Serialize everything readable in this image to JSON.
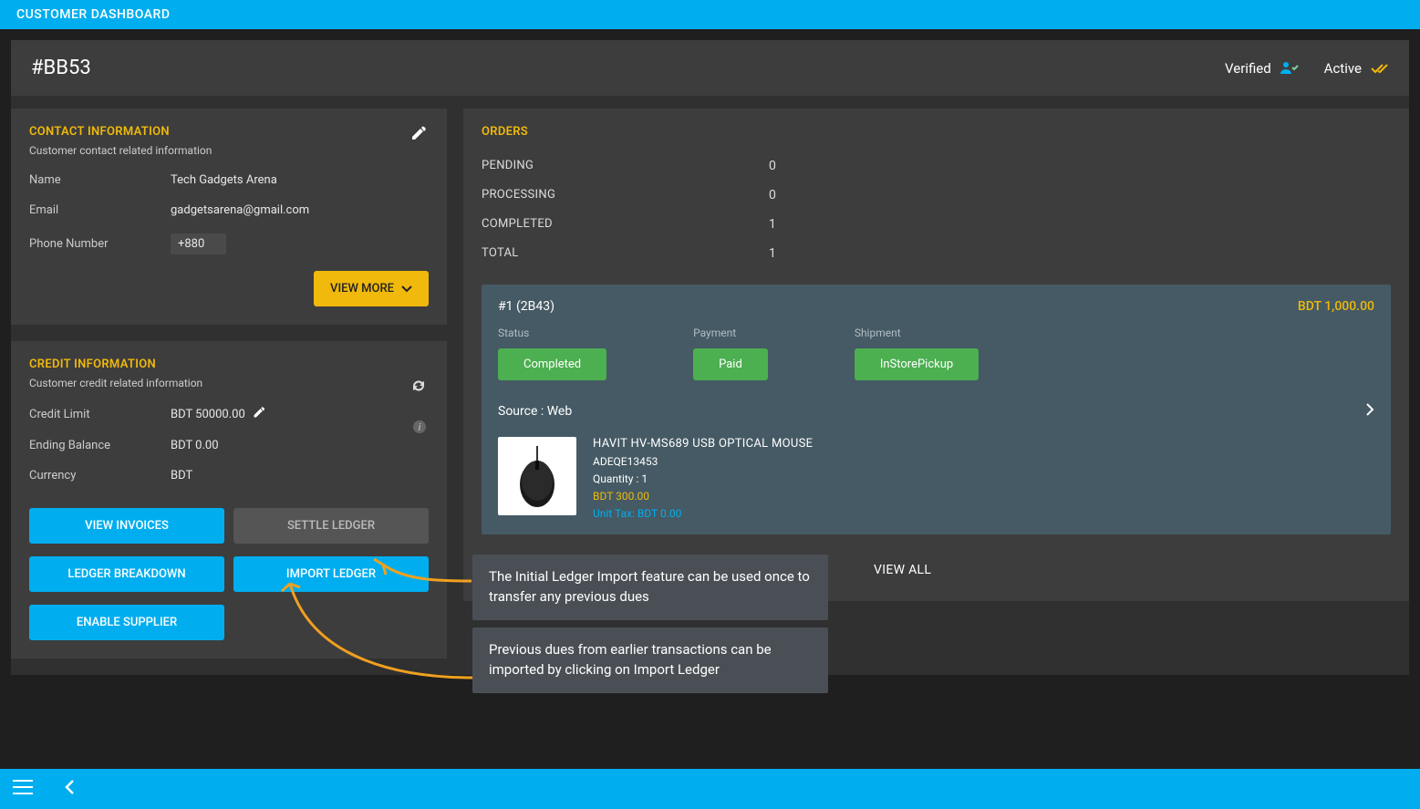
{
  "topbar": {
    "title": "CUSTOMER DASHBOARD"
  },
  "header": {
    "id": "#BB53",
    "verified_label": "Verified",
    "active_label": "Active"
  },
  "contact": {
    "title": "CONTACT INFORMATION",
    "subtitle": "Customer contact related information",
    "name_label": "Name",
    "name_value": "Tech Gadgets Arena",
    "email_label": "Email",
    "email_value": "gadgetsarena@gmail.com",
    "phone_label": "Phone Number",
    "phone_value": "+880",
    "view_more": "VIEW MORE"
  },
  "credit": {
    "title": "CREDIT INFORMATION",
    "subtitle": "Customer credit related information",
    "limit_label": "Credit Limit",
    "limit_value": "BDT 50000.00",
    "balance_label": "Ending Balance",
    "balance_value": "BDT 0.00",
    "currency_label": "Currency",
    "currency_value": "BDT",
    "btn_invoices": "VIEW INVOICES",
    "btn_settle": "SETTLE LEDGER",
    "btn_breakdown": "LEDGER BREAKDOWN",
    "btn_import": "IMPORT LEDGER",
    "btn_supplier": "ENABLE SUPPLIER"
  },
  "orders": {
    "title": "ORDERS",
    "pending_label": "PENDING",
    "pending_value": "0",
    "processing_label": "PROCESSING",
    "processing_value": "0",
    "completed_label": "COMPLETED",
    "completed_value": "1",
    "total_label": "TOTAL",
    "total_value": "1",
    "view_all": "VIEW ALL"
  },
  "order": {
    "num": "#1 (2B43)",
    "amount": "BDT 1,000.00",
    "status_label": "Status",
    "status_value": "Completed",
    "payment_label": "Payment",
    "payment_value": "Paid",
    "shipment_label": "Shipment",
    "shipment_value": "InStorePickup",
    "source": "Source : Web",
    "product_name": "HAVIT HV-MS689 USB OPTICAL MOUSE",
    "product_sku": "ADEQE13453",
    "product_qty": "Quantity : 1",
    "product_price": "BDT 300.00",
    "product_tax": "Unit Tax: BDT 0.00"
  },
  "annotations": {
    "tooltip1": "The Initial Ledger Import feature can be used once to transfer any previous dues",
    "tooltip2": "Previous dues from earlier transactions can be imported by clicking on Import Ledger"
  }
}
